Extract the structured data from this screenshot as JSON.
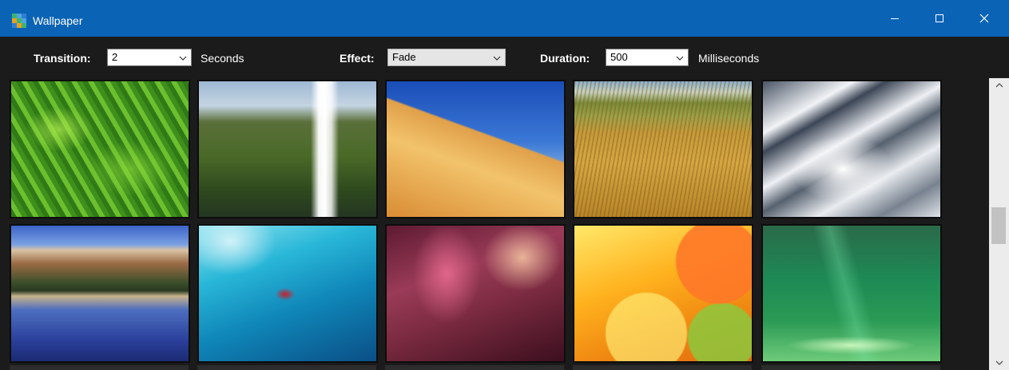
{
  "window": {
    "title": "Wallpaper",
    "icon": "app-grid-icon",
    "accent_color": "#0a63b5",
    "controls": {
      "minimize": "minimize-icon",
      "maximize": "maximize-icon",
      "close": "close-icon"
    }
  },
  "toolbar": {
    "transition": {
      "label": "Transition:",
      "value": "2",
      "unit": "Seconds"
    },
    "effect": {
      "label": "Effect:",
      "value": "Fade"
    },
    "duration": {
      "label": "Duration:",
      "value": "500",
      "unit": "Milliseconds"
    }
  },
  "wallpapers": [
    {
      "name": "fern"
    },
    {
      "name": "waterfall"
    },
    {
      "name": "desert-dune"
    },
    {
      "name": "wheat-field"
    },
    {
      "name": "snowy-mountains"
    },
    {
      "name": "mountain-lake"
    },
    {
      "name": "betta-fish"
    },
    {
      "name": "abstract-blur"
    },
    {
      "name": "bokeh-orange"
    },
    {
      "name": "green-aurora"
    }
  ],
  "scrollbar": {
    "up_icon": "chevron-up-icon",
    "down_icon": "chevron-down-icon"
  }
}
